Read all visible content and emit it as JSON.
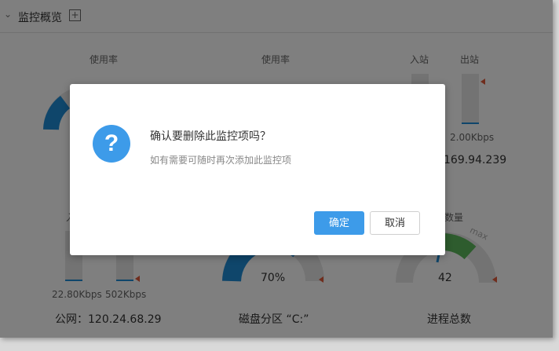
{
  "header": {
    "title": "监控概览"
  },
  "widgets": {
    "cpu_label": "使用率",
    "mem_label": "使用率",
    "net_in_label": "入站",
    "net_out_label": "出站",
    "net_out_value": "2.00Kbps",
    "private_ip": "169.94.239",
    "public_in_label": "入",
    "public_in_value": "22.80Kbps",
    "public_out_value": "502Kbps",
    "public_ip": "公网：120.24.68.29",
    "disk_value": "70%",
    "disk_label": "磁盘分区 “C:”",
    "process_label_partial": "数量",
    "process_max": "max",
    "process_value": "42",
    "process_label": "进程总数"
  },
  "dialog": {
    "title": "确认要删除此监控项吗？",
    "subtitle": "如有需要可随时再次添加此监控项",
    "ok_label": "确定",
    "cancel_label": "取消"
  },
  "colors": {
    "accent": "#3d9be9",
    "bar": "#1f8dd6",
    "green": "#5cb85c",
    "marker": "#e05a3a"
  }
}
